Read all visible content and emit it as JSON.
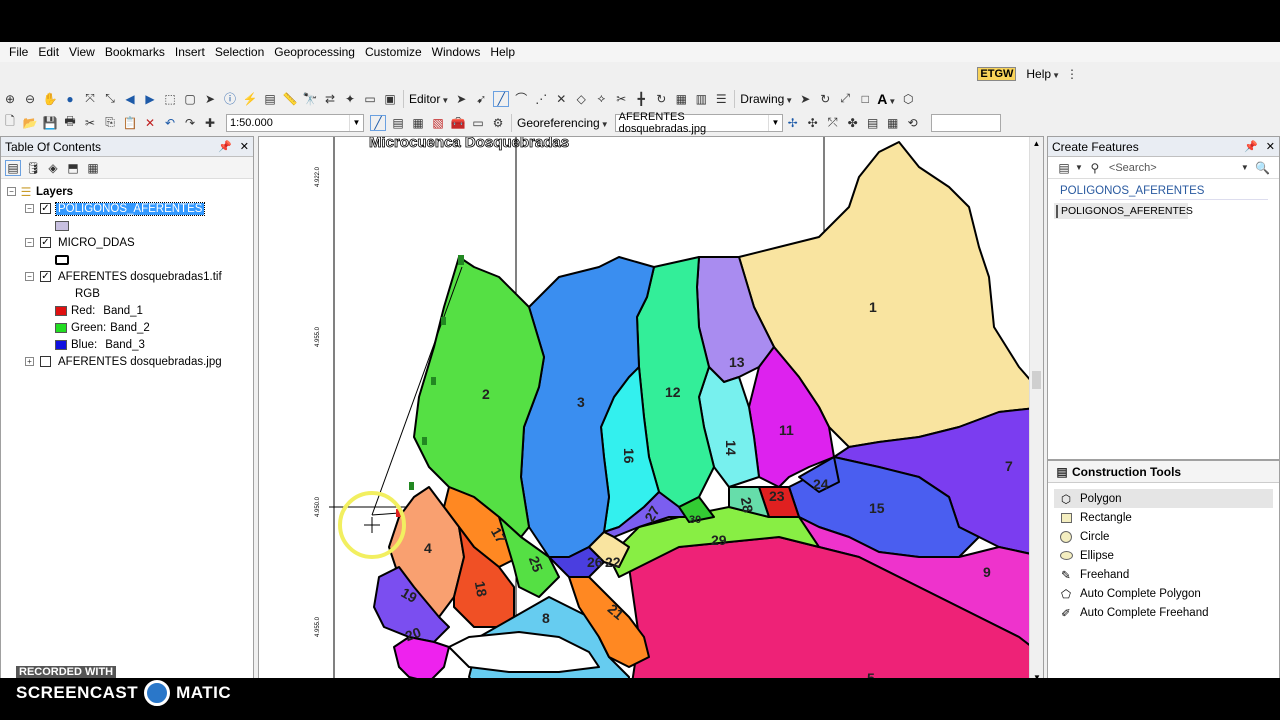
{
  "menu": [
    "File",
    "Edit",
    "View",
    "Bookmarks",
    "Insert",
    "Selection",
    "Geoprocessing",
    "Customize",
    "Windows",
    "Help"
  ],
  "toolbar": {
    "etgw_label": "ETGW",
    "help_label": "Help",
    "editor_label": "Editor",
    "drawing_label": "Drawing",
    "scale_value": "1:50.000",
    "georef_label": "Georeferencing",
    "georef_layer": "AFERENTES dosquebradas.jpg",
    "font_a": "A"
  },
  "toc": {
    "title": "Table Of Contents",
    "pin": "↕",
    "close": "✕",
    "root": "Layers",
    "layers": [
      {
        "name": "POLIGONOS_AFERENTES",
        "checked": true,
        "swatch": "#c8c0e0"
      },
      {
        "name": "MICRO_DDAS",
        "checked": true
      },
      {
        "name": "AFERENTES dosquebradas1.tif",
        "checked": true
      },
      {
        "name": "AFERENTES dosquebradas.jpg",
        "checked": false
      }
    ],
    "rgb": "RGB",
    "bands": [
      {
        "label": "Red:",
        "band": "Band_1",
        "color": "#e01010"
      },
      {
        "label": "Green:",
        "band": "Band_2",
        "color": "#22dd22"
      },
      {
        "label": "Blue:",
        "band": "Band_3",
        "color": "#1010e0"
      }
    ]
  },
  "map": {
    "title": "Microcuenca Dosquebradas",
    "polygon_labels": [
      "1",
      "2",
      "3",
      "4",
      "5",
      "7",
      "8",
      "9",
      "11",
      "12",
      "13",
      "14",
      "15",
      "16",
      "17",
      "18",
      "19",
      "20",
      "21",
      "22",
      "23",
      "24",
      "25",
      "26",
      "27",
      "28",
      "29",
      "30"
    ]
  },
  "create_features": {
    "title": "Create Features",
    "search_placeholder": "<Search>",
    "group": "POLIGONOS_AFERENTES",
    "template": "POLIGONOS_AFERENTES",
    "template_color": "#c8c0e0"
  },
  "construction_tools": {
    "title": "Construction Tools",
    "tools": [
      "Polygon",
      "Rectangle",
      "Circle",
      "Ellipse",
      "Freehand",
      "Auto Complete Polygon",
      "Auto Complete Freehand"
    ]
  },
  "watermark": {
    "recorded": "RECORDED WITH",
    "brand_left": "SCREENCAST",
    "brand_right": "MATIC"
  }
}
